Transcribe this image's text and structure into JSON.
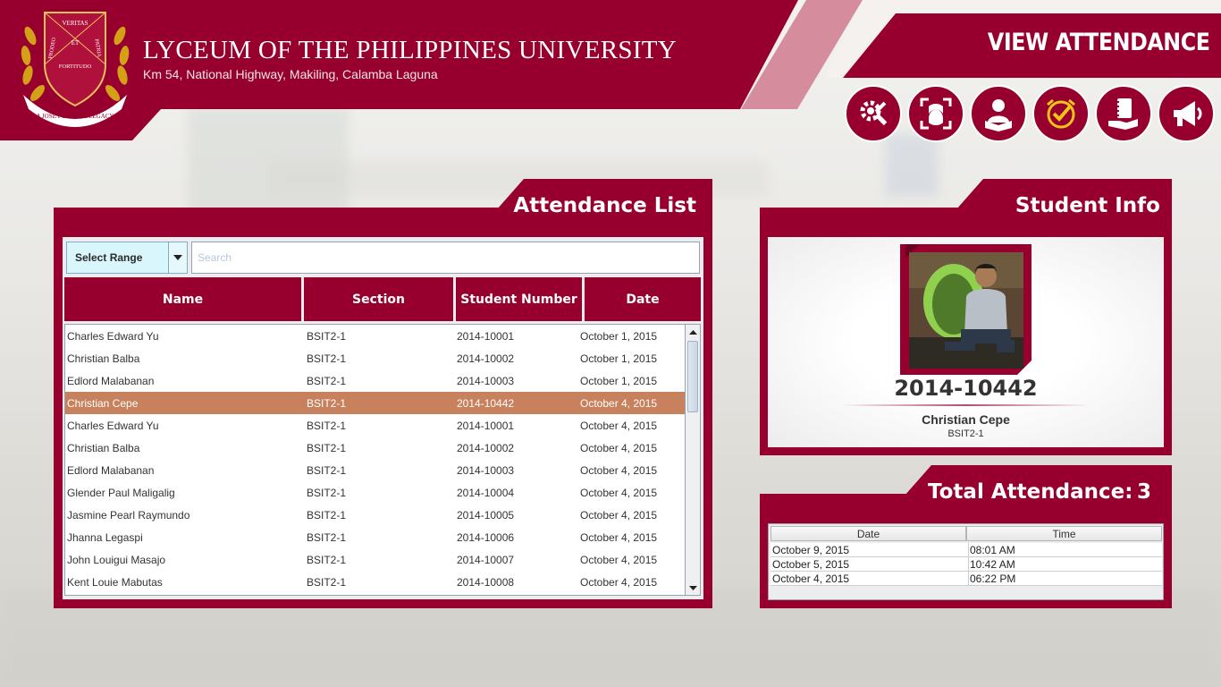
{
  "header": {
    "university_name": "LYCEUM OF THE PHILIPPINES UNIVERSITY",
    "address": "Km 54, National Highway, Makiling, Calamba Laguna",
    "page_title": "VIEW ATTENDANCE",
    "logo_text": [
      "VERITAS",
      "PRODEO",
      "PATRIA",
      "ET",
      "FORTITUDO",
      "A JOSE P LAUREL LEGACY"
    ],
    "nav_icons": [
      "settings-tools-icon",
      "face-scan-icon",
      "student-reading-icon",
      "attendance-clock-check-icon",
      "notebook-hand-icon",
      "megaphone-icon"
    ]
  },
  "attendance": {
    "title": "Attendance List",
    "range_select": "Select Range",
    "search_placeholder": "Search",
    "columns": [
      "Name",
      "Section",
      "Student Number",
      "Date"
    ],
    "rows": [
      [
        "Charles Edward Yu",
        "BSIT2-1",
        "2014-10001",
        "October 1, 2015"
      ],
      [
        "Christian Balba",
        "BSIT2-1",
        "2014-10002",
        "October 1, 2015"
      ],
      [
        "Edlord Malabanan",
        "BSIT2-1",
        "2014-10003",
        "October 1, 2015"
      ],
      [
        "Christian Cepe",
        "BSIT2-1",
        "2014-10442",
        "October 4, 2015"
      ],
      [
        "Charles Edward Yu",
        "BSIT2-1",
        "2014-10001",
        "October 4, 2015"
      ],
      [
        "Christian Balba",
        "BSIT2-1",
        "2014-10002",
        "October 4, 2015"
      ],
      [
        "Edlord Malabanan",
        "BSIT2-1",
        "2014-10003",
        "October 4, 2015"
      ],
      [
        "Glender Paul Maligalig",
        "BSIT2-1",
        "2014-10004",
        "October 4, 2015"
      ],
      [
        "Jasmine Pearl Raymundo",
        "BSIT2-1",
        "2014-10005",
        "October 4, 2015"
      ],
      [
        "Jhanna Legaspi",
        "BSIT2-1",
        "2014-10006",
        "October 4, 2015"
      ],
      [
        "John Louigui Masajo",
        "BSIT2-1",
        "2014-10007",
        "October 4, 2015"
      ],
      [
        "Kent Louie Mabutas",
        "BSIT2-1",
        "2014-10008",
        "October 4, 2015"
      ]
    ],
    "selected_row": 3
  },
  "student_info": {
    "title": "Student Info",
    "student_number": "2014-10442",
    "name": "Christian Cepe",
    "section": "BSIT2-1"
  },
  "total_attendance": {
    "label": "Total Attendance:",
    "count": "3",
    "columns": [
      "Date",
      "Time"
    ],
    "rows": [
      [
        "October 9, 2015",
        "08:01 AM"
      ],
      [
        "October 5, 2015",
        "10:42 AM"
      ],
      [
        "October 4, 2015",
        "06:22 PM"
      ]
    ]
  },
  "colors": {
    "brand": "#97002e",
    "selected_row": "#c7825d",
    "accent_light": "#d8f6fb"
  }
}
